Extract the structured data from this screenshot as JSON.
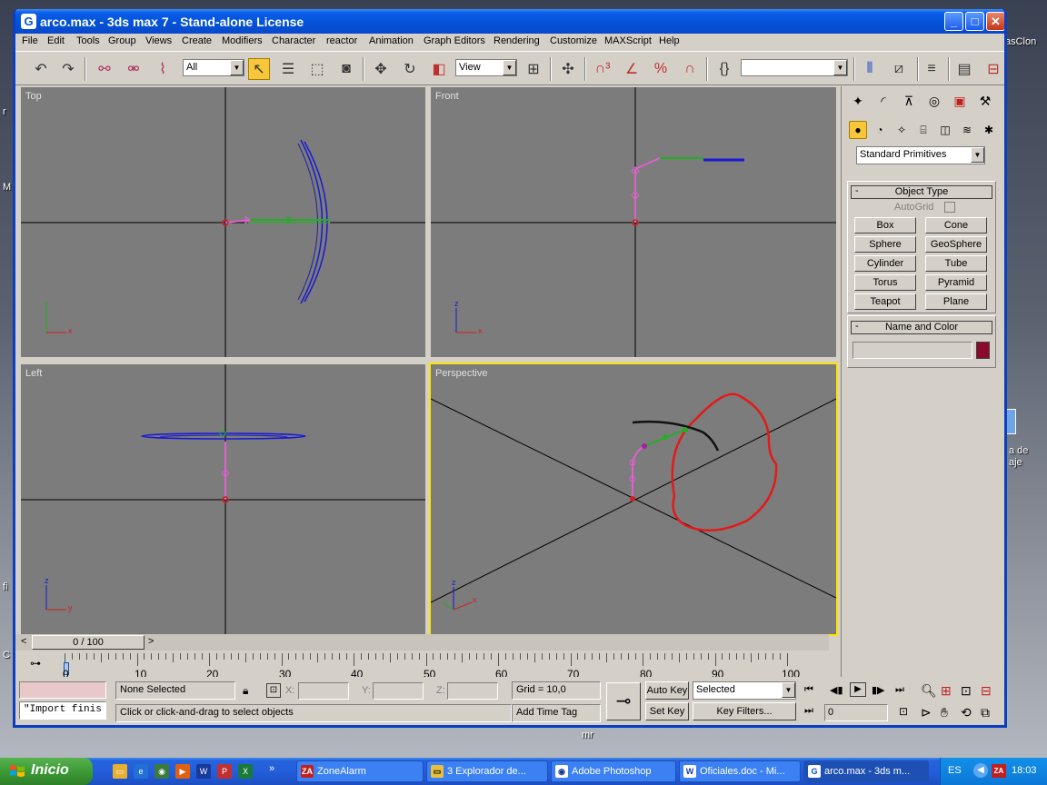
{
  "desktop": {
    "right_texts": [
      "asClon",
      "a de",
      "aje"
    ],
    "left_texts": [
      "r",
      "M",
      "fi",
      "C"
    ],
    "bottom_text": "mr"
  },
  "window": {
    "title": "arco.max - 3ds max 7  - Stand-alone License",
    "icon_glyph": "G",
    "controls": {
      "minimize": "_",
      "maximize": "□",
      "close": "✕"
    }
  },
  "menu": [
    "File",
    "Edit",
    "Tools",
    "Group",
    "Views",
    "Create",
    "Modifiers",
    "Character",
    "reactor",
    "Animation",
    "Graph Editors",
    "Rendering",
    "Customize",
    "MAXScript",
    "Help"
  ],
  "toolbar": {
    "selection_filter": "All",
    "ref_coord": "View",
    "named_selection": ""
  },
  "viewports": {
    "top": "Top",
    "front": "Front",
    "left": "Left",
    "perspective": "Perspective",
    "axis_x": "x",
    "axis_y": "y",
    "axis_z": "z"
  },
  "command_panel": {
    "category_dropdown": "Standard Primitives",
    "object_type_title": "Object Type",
    "autogrid": "AutoGrid",
    "buttons": [
      "Box",
      "Cone",
      "Sphere",
      "GeoSphere",
      "Cylinder",
      "Tube",
      "Torus",
      "Pyramid",
      "Teapot",
      "Plane"
    ],
    "name_color_title": "Name and Color",
    "name_value": "",
    "color": "#8b0a2a",
    "minus": "-"
  },
  "timeline": {
    "slider_text": "0 / 100",
    "prev": "<",
    "next": ">",
    "ticks": [
      "0",
      "10",
      "20",
      "30",
      "40",
      "50",
      "60",
      "70",
      "80",
      "90",
      "100"
    ]
  },
  "status": {
    "maxscript": "\"Import finis",
    "selection": "None Selected",
    "prompt": "Click or click-and-drag to select objects",
    "x_label": "X:",
    "y_label": "Y:",
    "z_label": "Z:",
    "grid": "Grid = 10,0",
    "add_time_tag": "Add Time Tag",
    "auto_key": "Auto Key",
    "set_key": "Set Key",
    "selected_dropdown": "Selected",
    "key_filters": "Key Filters...",
    "frame": "0"
  },
  "taskbar": {
    "start": "Inicio",
    "tasks": [
      "ZoneAlarm",
      "3 Explorador de...",
      "Adobe Photoshop",
      "Oficiales.doc - Mi...",
      "arco.max - 3ds m..."
    ],
    "lang": "ES",
    "clock": "18:03"
  }
}
